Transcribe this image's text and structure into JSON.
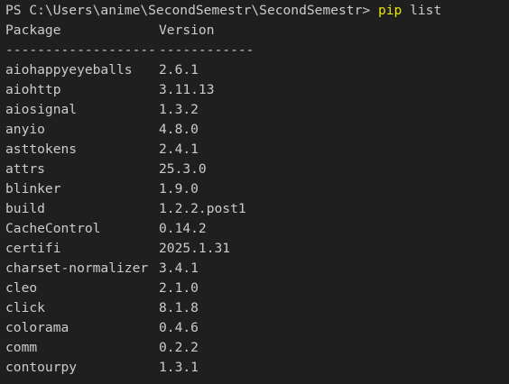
{
  "prompt": {
    "path": "PS C:\\Users\\anime\\SecondSemestr\\SecondSemestr> ",
    "command": "pip",
    "args": " list"
  },
  "header": {
    "package_label": "Package",
    "version_label": "Version",
    "package_rule": "-------------------",
    "version_rule": "------------"
  },
  "packages": [
    {
      "name": "aiohappyeyeballs",
      "version": "2.6.1"
    },
    {
      "name": "aiohttp",
      "version": "3.11.13"
    },
    {
      "name": "aiosignal",
      "version": "1.3.2"
    },
    {
      "name": "anyio",
      "version": "4.8.0"
    },
    {
      "name": "asttokens",
      "version": "2.4.1"
    },
    {
      "name": "attrs",
      "version": "25.3.0"
    },
    {
      "name": "blinker",
      "version": "1.9.0"
    },
    {
      "name": "build",
      "version": "1.2.2.post1"
    },
    {
      "name": "CacheControl",
      "version": "0.14.2"
    },
    {
      "name": "certifi",
      "version": "2025.1.31"
    },
    {
      "name": "charset-normalizer",
      "version": "3.4.1"
    },
    {
      "name": "cleo",
      "version": "2.1.0"
    },
    {
      "name": "click",
      "version": "8.1.8"
    },
    {
      "name": "colorama",
      "version": "0.4.6"
    },
    {
      "name": "comm",
      "version": "0.2.2"
    },
    {
      "name": "contourpy",
      "version": "1.3.1"
    }
  ],
  "colors": {
    "background": "#1f1f1f",
    "text": "#cccccc",
    "command": "#e5e510"
  }
}
